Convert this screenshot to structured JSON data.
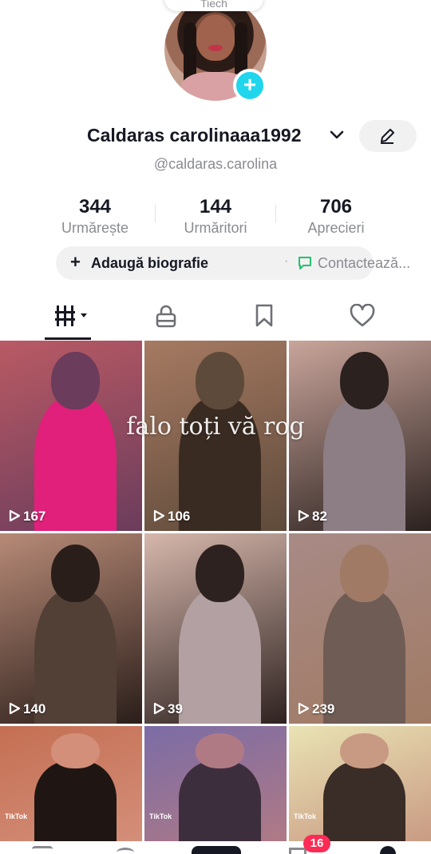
{
  "header": {
    "top_pill_label": "Tiech"
  },
  "profile": {
    "display_name": "Caldaras carolinaaa1992",
    "handle": "@caldaras.carolina"
  },
  "stats": [
    {
      "value": "344",
      "label": "Urmărește"
    },
    {
      "value": "144",
      "label": "Urmăritori"
    },
    {
      "value": "706",
      "label": "Aprecieri"
    }
  ],
  "bio": {
    "plus": "+",
    "add_label": "Adaugă biografie",
    "separator": "·",
    "contact_label": "Contactează..."
  },
  "tabs": [
    {
      "icon": "videos-grid-icon",
      "active": true
    },
    {
      "icon": "lock-icon",
      "active": false
    },
    {
      "icon": "bookmark-icon",
      "active": false
    },
    {
      "icon": "heart-icon",
      "active": false
    }
  ],
  "overlay_caption": "falo toți vă rog",
  "videos": [
    {
      "views": "167",
      "palette": [
        "#b95a64",
        "#e0207a",
        "#6b3c5c"
      ],
      "watermark": ""
    },
    {
      "views": "106",
      "palette": [
        "#a67a62",
        "#3a2b22",
        "#5e4a3a"
      ],
      "watermark": ""
    },
    {
      "views": "82",
      "palette": [
        "#c9a59b",
        "#8d7e86",
        "#2b211f"
      ],
      "watermark": ""
    },
    {
      "views": "140",
      "palette": [
        "#b78a77",
        "#524037",
        "#2a1e1a"
      ],
      "watermark": ""
    },
    {
      "views": "39",
      "palette": [
        "#d6b7ac",
        "#b3a0a2",
        "#2e2220"
      ],
      "watermark": ""
    },
    {
      "views": "239",
      "palette": [
        "#a88a86",
        "#6f5c55",
        "#a07a64"
      ],
      "watermark": ""
    },
    {
      "views": "",
      "palette": [
        "#c46f53",
        "#1f1613",
        "#d48f7a"
      ],
      "watermark": "TikTok"
    },
    {
      "views": "",
      "palette": [
        "#7b6ca6",
        "#3d2e3d",
        "#b07a85"
      ],
      "watermark": "TikTok"
    },
    {
      "views": "",
      "palette": [
        "#e9e3b4",
        "#3a2c26",
        "#c99a83"
      ],
      "watermark": "TikTok"
    }
  ],
  "bottom_nav": {
    "inbox_badge": "16"
  }
}
